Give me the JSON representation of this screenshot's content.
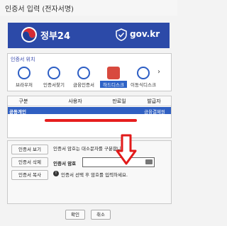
{
  "window": {
    "title": "인증서 입력 (전자서명)"
  },
  "banner": {
    "brand": "정부24",
    "domain": "gov.kr",
    "colors": {
      "background": "#2c4aa8"
    }
  },
  "location": {
    "label": "인증서 위치",
    "items": [
      {
        "label": "브라우저",
        "icon": "browser-icon"
      },
      {
        "label": "인증서찾기",
        "icon": "search-icon"
      },
      {
        "label": "금융인증서",
        "icon": "snowflake-icon"
      },
      {
        "label": "하드디스크",
        "icon": "harddisk-icon",
        "selected": true
      },
      {
        "label": "이동식디스크",
        "icon": "usb-icon"
      }
    ],
    "scroll_arrow": "›"
  },
  "cert_table": {
    "headers": [
      "구분",
      "사용자",
      "만료일",
      "발급자"
    ],
    "rows": [
      {
        "type": "공동개인",
        "user": "",
        "expiry": "",
        "issuer": "금융결제원"
      }
    ]
  },
  "actions": {
    "view": "인증서 보기",
    "delete": "인증서 삭제",
    "copy": "인증서 복사"
  },
  "password": {
    "hint": "인증서 암호는 대소문자를 구분합니다.",
    "label": "인증서 암호",
    "value": "",
    "note": "인증서 선택 후 암호를 입력하세요."
  },
  "footer": {
    "ok": "확인",
    "cancel": "취소"
  }
}
